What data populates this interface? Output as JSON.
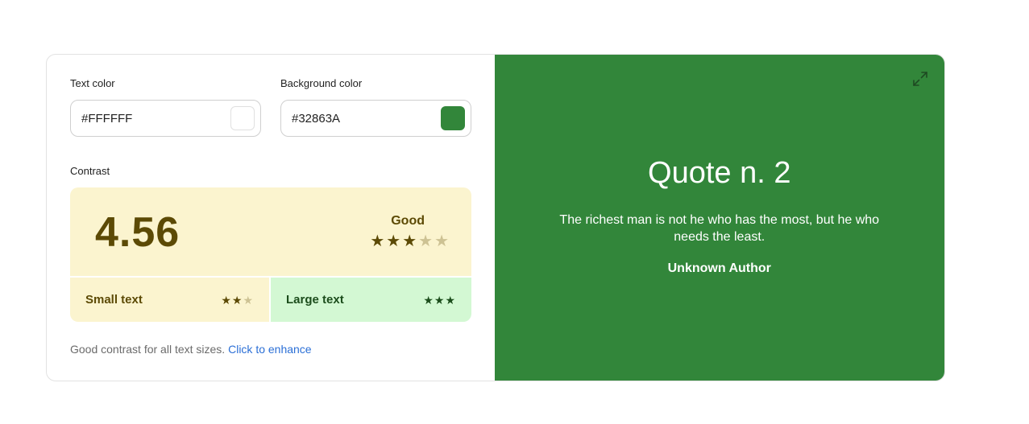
{
  "text_color": {
    "label": "Text color",
    "value": "#FFFFFF",
    "swatch": "#FFFFFF"
  },
  "background_color": {
    "label": "Background color",
    "value": "#32863A",
    "swatch": "#32863A"
  },
  "contrast": {
    "label": "Contrast",
    "ratio": "4.56",
    "rating": "Good",
    "stars": 3,
    "stars_total": 5,
    "small_text": {
      "label": "Small text",
      "stars": 2,
      "stars_total": 3
    },
    "large_text": {
      "label": "Large text",
      "stars": 3,
      "stars_total": 3
    }
  },
  "footer": {
    "message": "Good contrast for all text sizes.",
    "link": "Click to enhance"
  },
  "preview": {
    "title": "Quote n. 2",
    "text": "The richest man is not he who has the most, but he who needs the least.",
    "author": "Unknown Author"
  },
  "icons": {
    "expand": "expand-icon",
    "star": "star-icon"
  }
}
